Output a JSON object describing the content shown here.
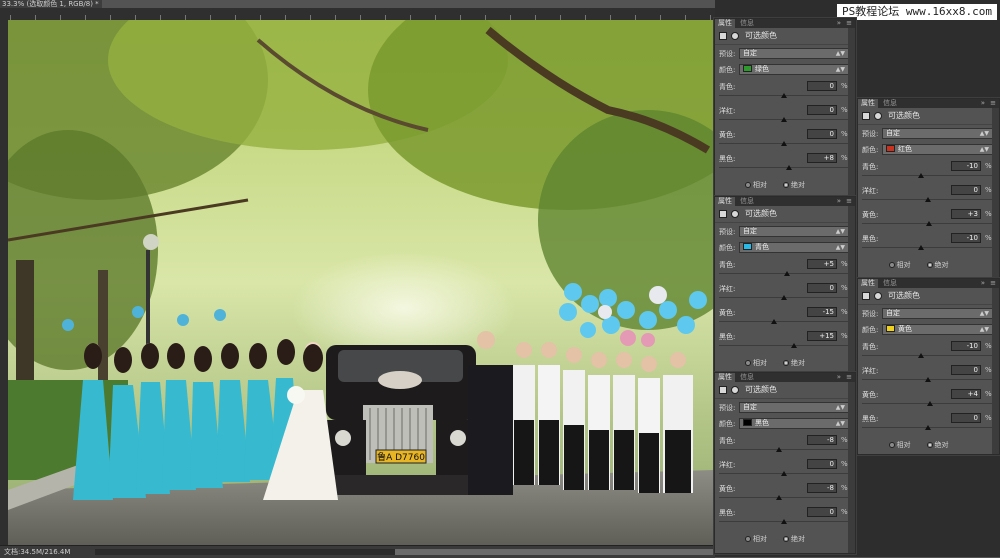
{
  "document": {
    "tab_title": "33.3% (选取颜色 1, RGB/8) *",
    "status": "文档:34.5M/216.4M"
  },
  "watermark": {
    "text": "PS教程论坛 www.16xx8.com"
  },
  "photo": {
    "plate": "鲁A D7760"
  },
  "panels": [
    {
      "id": "green",
      "tabs": [
        "属性",
        "信息"
      ],
      "title": "可选颜色",
      "preset_label": "预设:",
      "preset_value": "自定",
      "color_label": "颜色:",
      "color_name": "绿色",
      "color_hex": "#2e9a2e",
      "sliders": [
        {
          "label": "青色:",
          "value": "0",
          "level": 0
        },
        {
          "label": "洋红:",
          "value": "0",
          "level": 0
        },
        {
          "label": "黄色:",
          "value": "0",
          "level": 0
        },
        {
          "label": "黑色:",
          "value": "+8",
          "level": 8
        }
      ],
      "radio_relative": "相对",
      "radio_absolute": "绝对",
      "selected": "绝对"
    },
    {
      "id": "red",
      "tabs": [
        "属性",
        "信息"
      ],
      "title": "可选颜色",
      "preset_label": "预设:",
      "preset_value": "自定",
      "color_label": "颜色:",
      "color_name": "红色",
      "color_hex": "#c8321e",
      "sliders": [
        {
          "label": "青色:",
          "value": "-10",
          "level": -10
        },
        {
          "label": "洋红:",
          "value": "0",
          "level": 0
        },
        {
          "label": "黄色:",
          "value": "+3",
          "level": 3
        },
        {
          "label": "黑色:",
          "value": "-10",
          "level": -10
        }
      ],
      "radio_relative": "相对",
      "radio_absolute": "绝对",
      "selected": "绝对"
    },
    {
      "id": "cyan",
      "tabs": [
        "属性",
        "信息"
      ],
      "title": "可选颜色",
      "preset_label": "预设:",
      "preset_value": "自定",
      "color_label": "颜色:",
      "color_name": "青色",
      "color_hex": "#2ab8e6",
      "sliders": [
        {
          "label": "青色:",
          "value": "+5",
          "level": 5
        },
        {
          "label": "洋红:",
          "value": "0",
          "level": 0
        },
        {
          "label": "黄色:",
          "value": "-15",
          "level": -15
        },
        {
          "label": "黑色:",
          "value": "+15",
          "level": 15
        }
      ],
      "radio_relative": "相对",
      "radio_absolute": "绝对",
      "selected": "绝对"
    },
    {
      "id": "yellow",
      "tabs": [
        "属性",
        "信息"
      ],
      "title": "可选颜色",
      "preset_label": "预设:",
      "preset_value": "自定",
      "color_label": "颜色:",
      "color_name": "黄色",
      "color_hex": "#f0d21e",
      "sliders": [
        {
          "label": "青色:",
          "value": "-10",
          "level": -10
        },
        {
          "label": "洋红:",
          "value": "0",
          "level": 0
        },
        {
          "label": "黄色:",
          "value": "+4",
          "level": 4
        },
        {
          "label": "黑色:",
          "value": "0",
          "level": 0
        }
      ],
      "radio_relative": "相对",
      "radio_absolute": "绝对",
      "selected": "绝对"
    },
    {
      "id": "black",
      "tabs": [
        "属性",
        "信息"
      ],
      "title": "可选颜色",
      "preset_label": "预设:",
      "preset_value": "自定",
      "color_label": "颜色:",
      "color_name": "黑色",
      "color_hex": "#000000",
      "sliders": [
        {
          "label": "青色:",
          "value": "-8",
          "level": -8
        },
        {
          "label": "洋红:",
          "value": "0",
          "level": 0
        },
        {
          "label": "黄色:",
          "value": "-8",
          "level": -8
        },
        {
          "label": "黑色:",
          "value": "0",
          "level": 0
        }
      ],
      "radio_relative": "相对",
      "radio_absolute": "绝对",
      "selected": "绝对"
    }
  ],
  "pct_sign": "%"
}
